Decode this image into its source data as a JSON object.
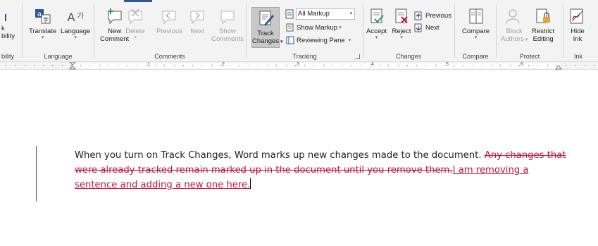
{
  "ribbon": {
    "accessibility_group": {
      "line1": "k",
      "line2": "bility",
      "label": "bility"
    },
    "language_group": {
      "label": "Language",
      "translate": "Translate",
      "language": "Language"
    },
    "comments_group": {
      "label": "Comments",
      "new_comment_line1": "New",
      "new_comment_line2": "Comment",
      "delete": "Delete",
      "previous": "Previous",
      "next": "Next",
      "show_comments_line1": "Show",
      "show_comments_line2": "Comments"
    },
    "tracking_group": {
      "label": "Tracking",
      "track_changes_line1": "Track",
      "track_changes_line2": "Changes",
      "markup_dropdown": "All Markup",
      "show_markup": "Show Markup",
      "reviewing_pane": "Reviewing Pane"
    },
    "changes_group": {
      "label": "Changes",
      "accept": "Accept",
      "reject": "Reject",
      "previous": "Previous",
      "next": "Next"
    },
    "compare_group": {
      "label": "Compare",
      "compare": "Compare"
    },
    "protect_group": {
      "label": "Protect",
      "block_authors_line1": "Block",
      "block_authors_line2": "Authors",
      "restrict_editing_line1": "Restrict",
      "restrict_editing_line2": "Editing"
    },
    "ink_group": {
      "label": "Ink",
      "hide_ink_line1": "Hide",
      "hide_ink_line2": "Ink"
    }
  },
  "ruler": {
    "numbers": [
      "1",
      "2",
      "3",
      "4",
      "5",
      "6"
    ]
  },
  "document": {
    "text_normal": "When you turn on Track Changes, Word marks up new changes made to the document. ",
    "text_deleted": "Any changes that were already tracked remain marked up in the document until you remove them.",
    "text_inserted": "I am removing a sentence and adding a new one here."
  },
  "colors": {
    "revision": "#c0143c",
    "accent": "#2b579a"
  }
}
